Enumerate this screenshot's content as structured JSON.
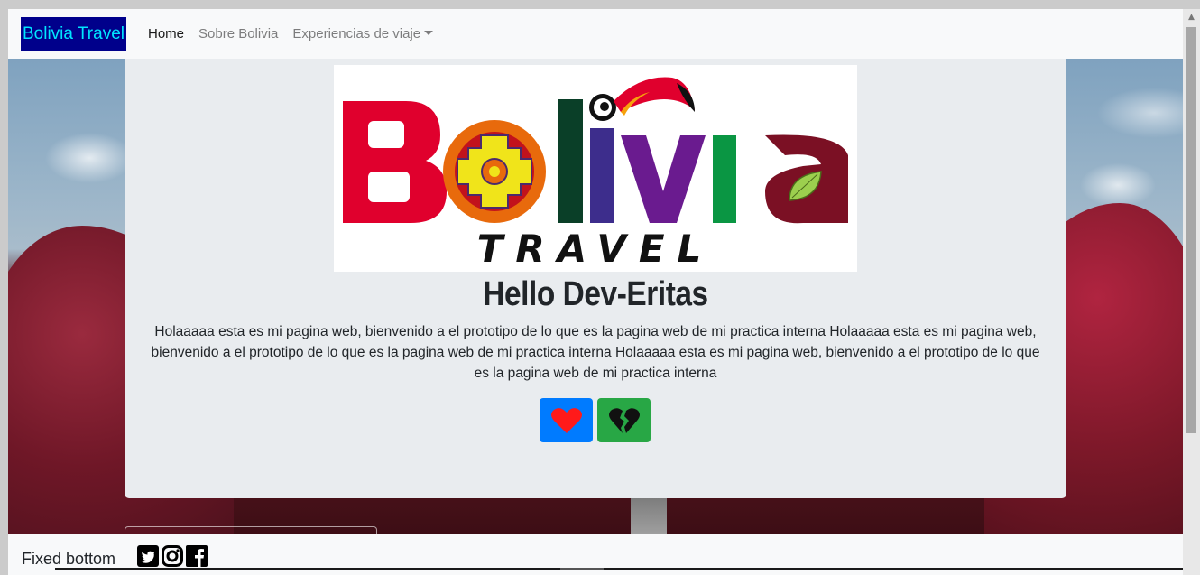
{
  "navbar": {
    "brand": "Bolivia Travel",
    "links": [
      {
        "label": "Home",
        "active": true
      },
      {
        "label": "Sobre Bolivia",
        "active": false
      },
      {
        "label": "Experiencias de viaje",
        "active": false,
        "dropdown": true
      }
    ]
  },
  "logo": {
    "word": "Bolivia",
    "tagline": "TRAVEL"
  },
  "hero": {
    "title": "Hello Dev-Eritas",
    "text": "Holaaaaa esta es mi pagina web, bienvenido a el prototipo de lo que es la pagina web de mi practica interna Holaaaaa esta es mi pagina web, bienvenido a el prototipo de lo que es la pagina web de mi practica interna Holaaaaa esta es mi pagina web, bienvenido a el prototipo de lo que es la pagina web de mi practica interna",
    "buttons": [
      {
        "icon": "heart-icon",
        "color": "#007bff"
      },
      {
        "icon": "broken-heart-icon",
        "color": "#28a745"
      }
    ]
  },
  "footer": {
    "text": "Fixed bottom",
    "icons": [
      "twitter-icon",
      "instagram-icon",
      "facebook-icon"
    ]
  },
  "colors": {
    "brand_bg": "#00008b",
    "brand_text": "#00e5ff",
    "primary": "#007bff",
    "success": "#28a745",
    "jumbotron": "#e9ecef"
  }
}
